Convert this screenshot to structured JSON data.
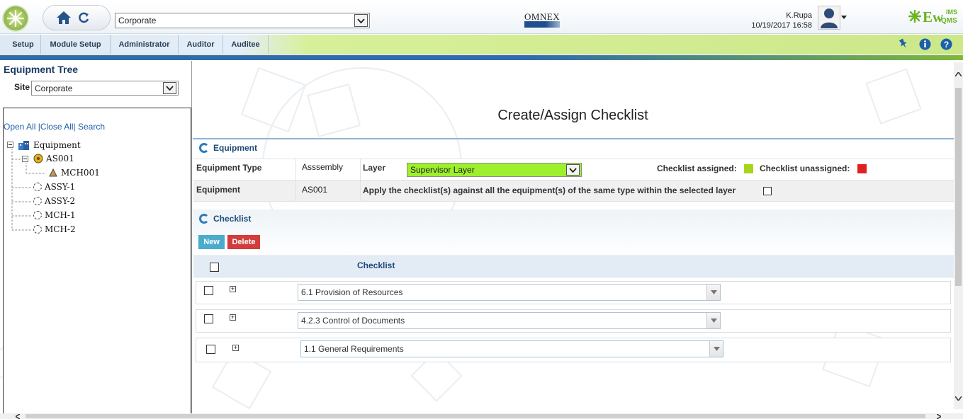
{
  "header": {
    "site_select": "Corporate",
    "brand_center": "OMNEX",
    "user_name": "K.Rupa",
    "datetime": "10/19/2017 16:58",
    "brand_right": "Ew",
    "brand_right_small_top": "IMS",
    "brand_right_small_bottom": "QMS"
  },
  "menu": {
    "items": [
      "Setup",
      "Module Setup",
      "Administrator",
      "Auditor",
      "Auditee"
    ]
  },
  "left": {
    "title": "Equipment Tree",
    "site_label": "Site",
    "site_value": "Corporate",
    "open_all": "Open All",
    "close_all": "Close All",
    "search": "Search",
    "sep1": "|",
    "sep2": "|",
    "tree": {
      "root": "Equipment",
      "child1": "AS001",
      "grandchild1": "MCH001",
      "child2": "ASSY-1",
      "child3": "ASSY-2",
      "child4": "MCH-1",
      "child5": "MCH-2"
    }
  },
  "main": {
    "page_title": "Create/Assign Checklist",
    "equipment_section": "Equipment",
    "equipment_type_label": "Equipment Type",
    "equipment_type_value": "Asssembly",
    "layer_label": "Layer",
    "layer_value": "Supervisor Layer",
    "assigned_label": "Checklist assigned:",
    "unassigned_label": "Checklist unassigned:",
    "equipment_label": "Equipment",
    "equipment_value": "AS001",
    "apply_text": "Apply the checklist(s) against all the equipment(s) of the same type within the selected layer",
    "checklist_section": "Checklist",
    "new_button": "New",
    "delete_button": "Delete",
    "grid_header": "Checklist",
    "rows": [
      "6.1 Provision of Resources",
      "4.2.3 Control of Documents",
      "1.1 General Requirements"
    ]
  },
  "colors": {
    "assigned": "#a6d61c",
    "unassigned": "#e02020",
    "new_button": "#4aaccc",
    "delete_button": "#d23c3c",
    "layer_highlight": "#9df02b"
  }
}
